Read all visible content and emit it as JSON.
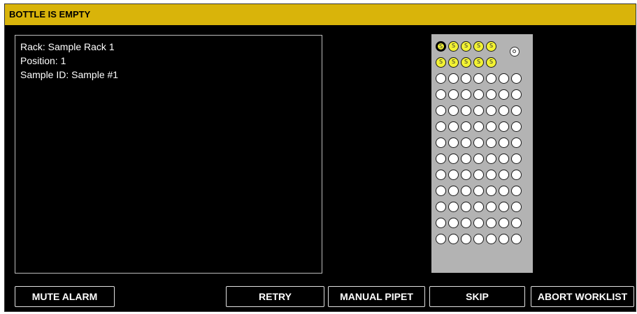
{
  "dialog": {
    "title": "BOTTLE IS EMPTY"
  },
  "info": {
    "rack_line": "Rack: Sample Rack 1",
    "position_line": "Position: 1",
    "sample_id_line": "Sample ID: Sample #1"
  },
  "rack_grid": {
    "columns": 7,
    "rows": 13,
    "sample_wells_row1": 5,
    "sample_wells_row2": 5,
    "selected_well": 1,
    "sample_glyph": "S",
    "colors": {
      "rack_background": "#b3b3b3",
      "sample_well": "#f2f233",
      "empty_well": "#ffffff"
    }
  },
  "buttons": {
    "mute_alarm": "MUTE ALARM",
    "retry": "RETRY",
    "manual_pipet": "MANUAL PIPET",
    "skip": "SKIP",
    "abort_worklist": "ABORT WORKLIST"
  },
  "colors": {
    "title_bar": "#d9b40a",
    "background": "#000000",
    "text": "#ffffff"
  }
}
